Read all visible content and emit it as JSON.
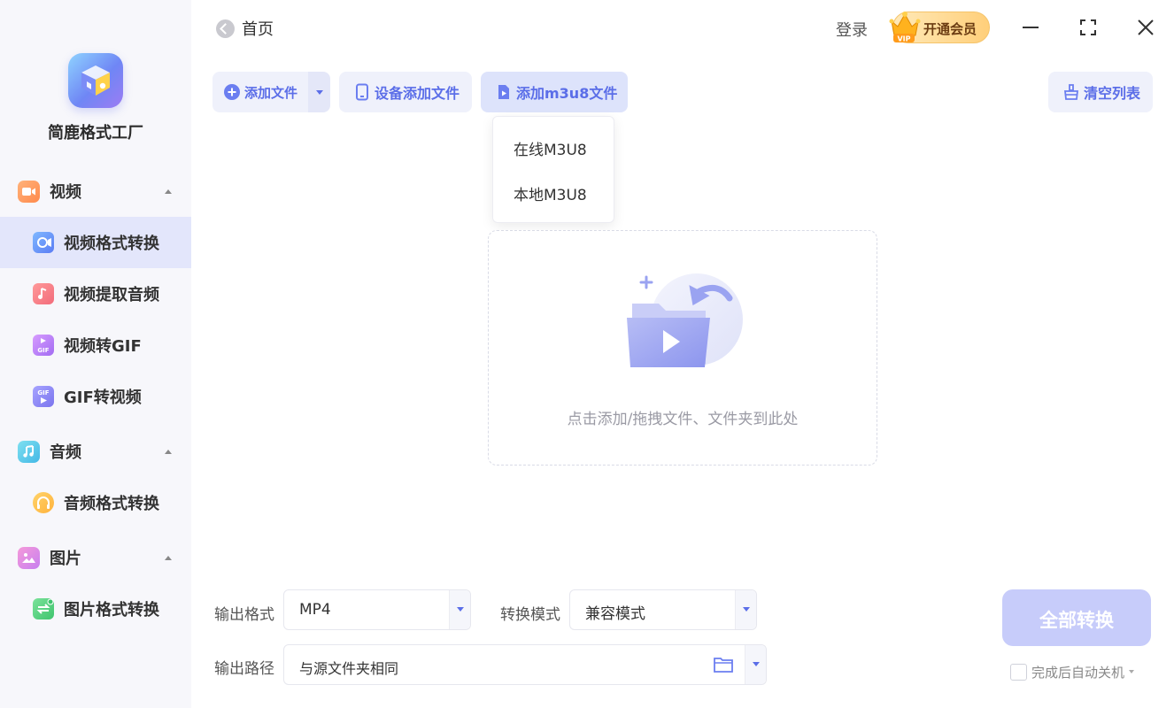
{
  "app": {
    "name": "简鹿格式工厂"
  },
  "sidebar": {
    "groups": [
      {
        "label": "视频",
        "icon": "video-camera-icon",
        "items": [
          {
            "label": "视频格式转换",
            "icon": "video-convert-icon",
            "active": true
          },
          {
            "label": "视频提取音频",
            "icon": "music-note-icon"
          },
          {
            "label": "视频转GIF",
            "icon": "video-to-gif-icon"
          },
          {
            "label": "GIF转视频",
            "icon": "gif-to-video-icon"
          }
        ]
      },
      {
        "label": "音频",
        "icon": "audio-icon",
        "items": [
          {
            "label": "音频格式转换",
            "icon": "headphones-icon"
          }
        ]
      },
      {
        "label": "图片",
        "icon": "image-icon",
        "items": [
          {
            "label": "图片格式转换",
            "icon": "image-convert-icon"
          }
        ]
      }
    ]
  },
  "topbar": {
    "home_label": "首页",
    "login_label": "登录",
    "vip_label": "开通会员",
    "vip_badge": "VIP"
  },
  "toolbar": {
    "add_file_label": "添加文件",
    "device_add_label": "设备添加文件",
    "add_m3u8_label": "添加m3u8文件",
    "clear_label": "清空列表"
  },
  "m3u8_menu": {
    "items": [
      "在线M3U8",
      "本地M3U8"
    ]
  },
  "dropzone": {
    "hint": "点击添加/拖拽文件、文件夹到此处"
  },
  "settings": {
    "output_format_label": "输出格式",
    "output_format_value": "MP4",
    "convert_mode_label": "转换模式",
    "convert_mode_value": "兼容模式",
    "output_path_label": "输出路径",
    "output_path_value": "与源文件夹相同"
  },
  "actions": {
    "convert_all_label": "全部转换",
    "auto_shutdown_label": "完成后自动关机",
    "auto_shutdown_checked": false
  },
  "colors": {
    "accent": "#5b6ee8",
    "sidebar_bg": "#f7f7fb",
    "active_item_bg": "#e3e6fb",
    "convert_btn": "#c7ccfa"
  }
}
